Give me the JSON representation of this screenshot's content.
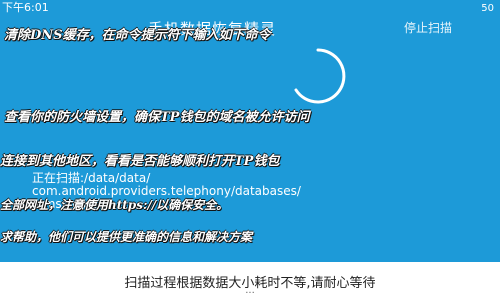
{
  "status_bar": {
    "time": "下午6:01",
    "right": "50"
  },
  "app": {
    "title": "手机数据恢复精灵",
    "top_right": "停止扫描"
  },
  "overlays": [
    "清除DNS缓存，在命令提示符下输入如下命令",
    "查看你的防火墙设置，确保TP钱包的域名被允许访问",
    "连接到其他地区，看看是否能够顺利打开TP钱包",
    "全部网址，注意使用https://以确保安全。",
    "求帮助，他们可以提供更准确的信息和解决方案"
  ],
  "scan": {
    "label": "正在扫描:/data/data/",
    "path_line1": "com.android.providers.telephony/databases/",
    "path_line2": "mmssms.db"
  },
  "footer": {
    "text": "扫描过程根据数据大小耗时不等,请耐心等待",
    "dots": "···"
  },
  "colors": {
    "background": "#1d9ad8",
    "panel": "#ffffff",
    "spinner": "#ffffff"
  }
}
